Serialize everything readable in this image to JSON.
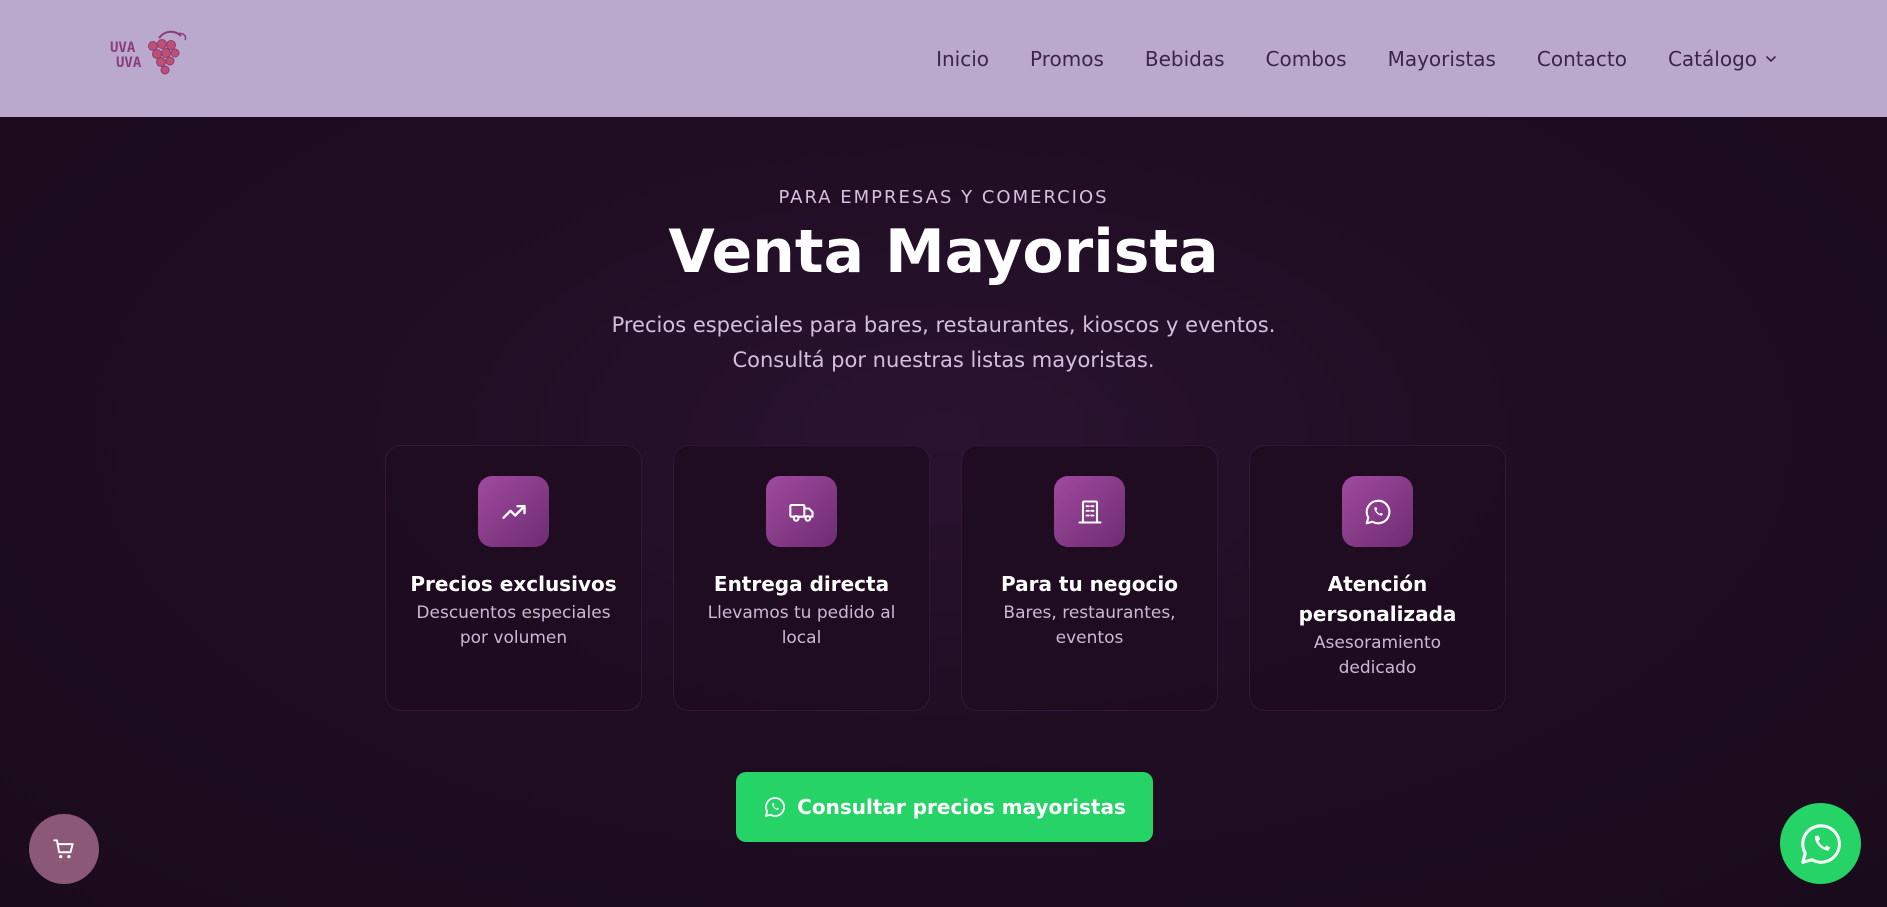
{
  "brand": {
    "logo_text_line1": "UVA",
    "logo_text_line2": "UVA"
  },
  "nav": {
    "items": [
      {
        "label": "Inicio"
      },
      {
        "label": "Promos"
      },
      {
        "label": "Bebidas"
      },
      {
        "label": "Combos"
      },
      {
        "label": "Mayoristas"
      },
      {
        "label": "Contacto"
      },
      {
        "label": "Catálogo",
        "icon": "chevron-down-icon"
      }
    ]
  },
  "hero": {
    "eyebrow": "PARA EMPRESAS Y COMERCIOS",
    "title": "Venta Mayorista",
    "subtitle_line1": "Precios especiales para bares, restaurantes, kioscos y eventos.",
    "subtitle_line2": "Consultá por nuestras listas mayoristas."
  },
  "features": [
    {
      "icon": "trending-up-icon",
      "title": "Precios exclusivos",
      "description": "Descuentos especiales por volumen"
    },
    {
      "icon": "truck-icon",
      "title": "Entrega directa",
      "description": "Llevamos tu pedido al local"
    },
    {
      "icon": "building-icon",
      "title": "Para tu negocio",
      "description": "Bares, restaurantes, eventos"
    },
    {
      "icon": "whatsapp-icon",
      "title": "Atención personalizada",
      "description": "Asesoramiento dedicado"
    }
  ],
  "cta": {
    "label": "Consultar precios mayoristas",
    "icon": "whatsapp-icon"
  },
  "floating": {
    "cart_icon": "cart-icon",
    "whatsapp_icon": "whatsapp-icon"
  },
  "colors": {
    "navbar_bg": "#bba8cd",
    "page_bg": "#1d0c1f",
    "accent": "#9b4597",
    "cta_green": "#25d366"
  }
}
